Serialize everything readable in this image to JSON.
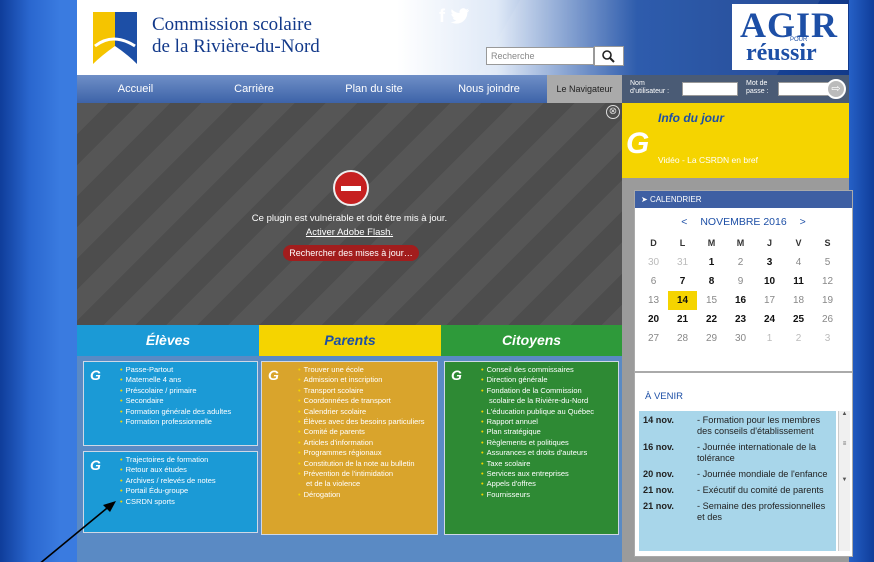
{
  "header": {
    "title_line1": "Commission scolaire",
    "title_line2": "de la Rivière-du-Nord",
    "social": "f",
    "search_placeholder": "Recherche",
    "slogan_top": "AGIR",
    "slogan_pour": "POUR",
    "slogan_bottom": "réussir"
  },
  "nav": {
    "items": [
      "Accueil",
      "Carrière",
      "Plan du site",
      "Nous joindre"
    ],
    "navigator": "Le Navigateur",
    "username_label_1": "Nom",
    "username_label_2": "d'utilisateur :",
    "password_label_1": "Mot de",
    "password_label_2": "passe :",
    "go": "⇨"
  },
  "flash": {
    "message": "Ce plugin est vulnérable et doit être mis à jour.",
    "activate": "Activer Adobe Flash.",
    "update_button": "Rechercher des mises à jour…",
    "close": "⊗"
  },
  "columns": [
    {
      "title": "Élèves",
      "color": "#1b9ad6"
    },
    {
      "title": "Parents",
      "color": "#f5d400"
    },
    {
      "title": "Citoyens",
      "color": "#2e9a3a"
    }
  ],
  "eleves_box1": [
    "Passe-Partout",
    "Maternelle 4 ans",
    "Préscolaire / primaire",
    "Secondaire",
    "Formation générale des adultes",
    "Formation professionnelle"
  ],
  "eleves_box2": [
    "Trajectoires de formation",
    "Retour aux études",
    "Archives / relevés de notes",
    "Portail Édu-groupe",
    "CSRDN sports"
  ],
  "parents_list": [
    "Trouver une école",
    "Admission et inscription",
    "Transport scolaire",
    "Coordonnées de transport",
    "Calendrier scolaire",
    "Élèves avec des besoins particuliers",
    "Comité de parents",
    "Articles d'information",
    "Programmes régionaux",
    "Constitution de la note au bulletin",
    "Prévention de l'intimidation",
    "et de la violence",
    "Dérogation"
  ],
  "citoyens_list": [
    "Conseil des commissaires",
    "Direction générale",
    "Fondation de la Commission",
    "scolaire de la Rivière-du-Nord",
    "L'éducation publique au Québec",
    "Rapport annuel",
    "Plan stratégique",
    "Règlements et politiques",
    "Assurances et droits d'auteurs",
    "Taxe scolaire",
    "Services aux entreprises",
    "Appels d'offres",
    "Fournisseurs"
  ],
  "info": {
    "title": "Info du jour",
    "video": "Vidéo - La CSRDN en bref"
  },
  "calendar": {
    "header": "CALENDRIER",
    "month": "NOVEMBRE 2016",
    "prev": "<",
    "next": ">",
    "day_heads": [
      "D",
      "L",
      "M",
      "M",
      "J",
      "V",
      "S"
    ],
    "days": [
      "30",
      "31",
      "1",
      "2",
      "3",
      "4",
      "5",
      "6",
      "7",
      "8",
      "9",
      "10",
      "11",
      "12",
      "13",
      "14",
      "15",
      "16",
      "17",
      "18",
      "19",
      "20",
      "21",
      "22",
      "23",
      "24",
      "25",
      "26",
      "27",
      "28",
      "29",
      "30",
      "1",
      "2",
      "3"
    ],
    "today": "14"
  },
  "avenir": {
    "title": "À VENIR",
    "events": [
      {
        "date": "14 nov.",
        "text": "- Formation pour les membres des conseils d'établissement"
      },
      {
        "date": "16 nov.",
        "text": "- Journée internationale de la tolérance"
      },
      {
        "date": "20 nov.",
        "text": "- Journée mondiale de l'enfance"
      },
      {
        "date": "21 nov.",
        "text": "- Exécutif du comité de parents"
      },
      {
        "date": "21 nov.",
        "text": "- Semaine des professionnelles et des"
      }
    ]
  }
}
